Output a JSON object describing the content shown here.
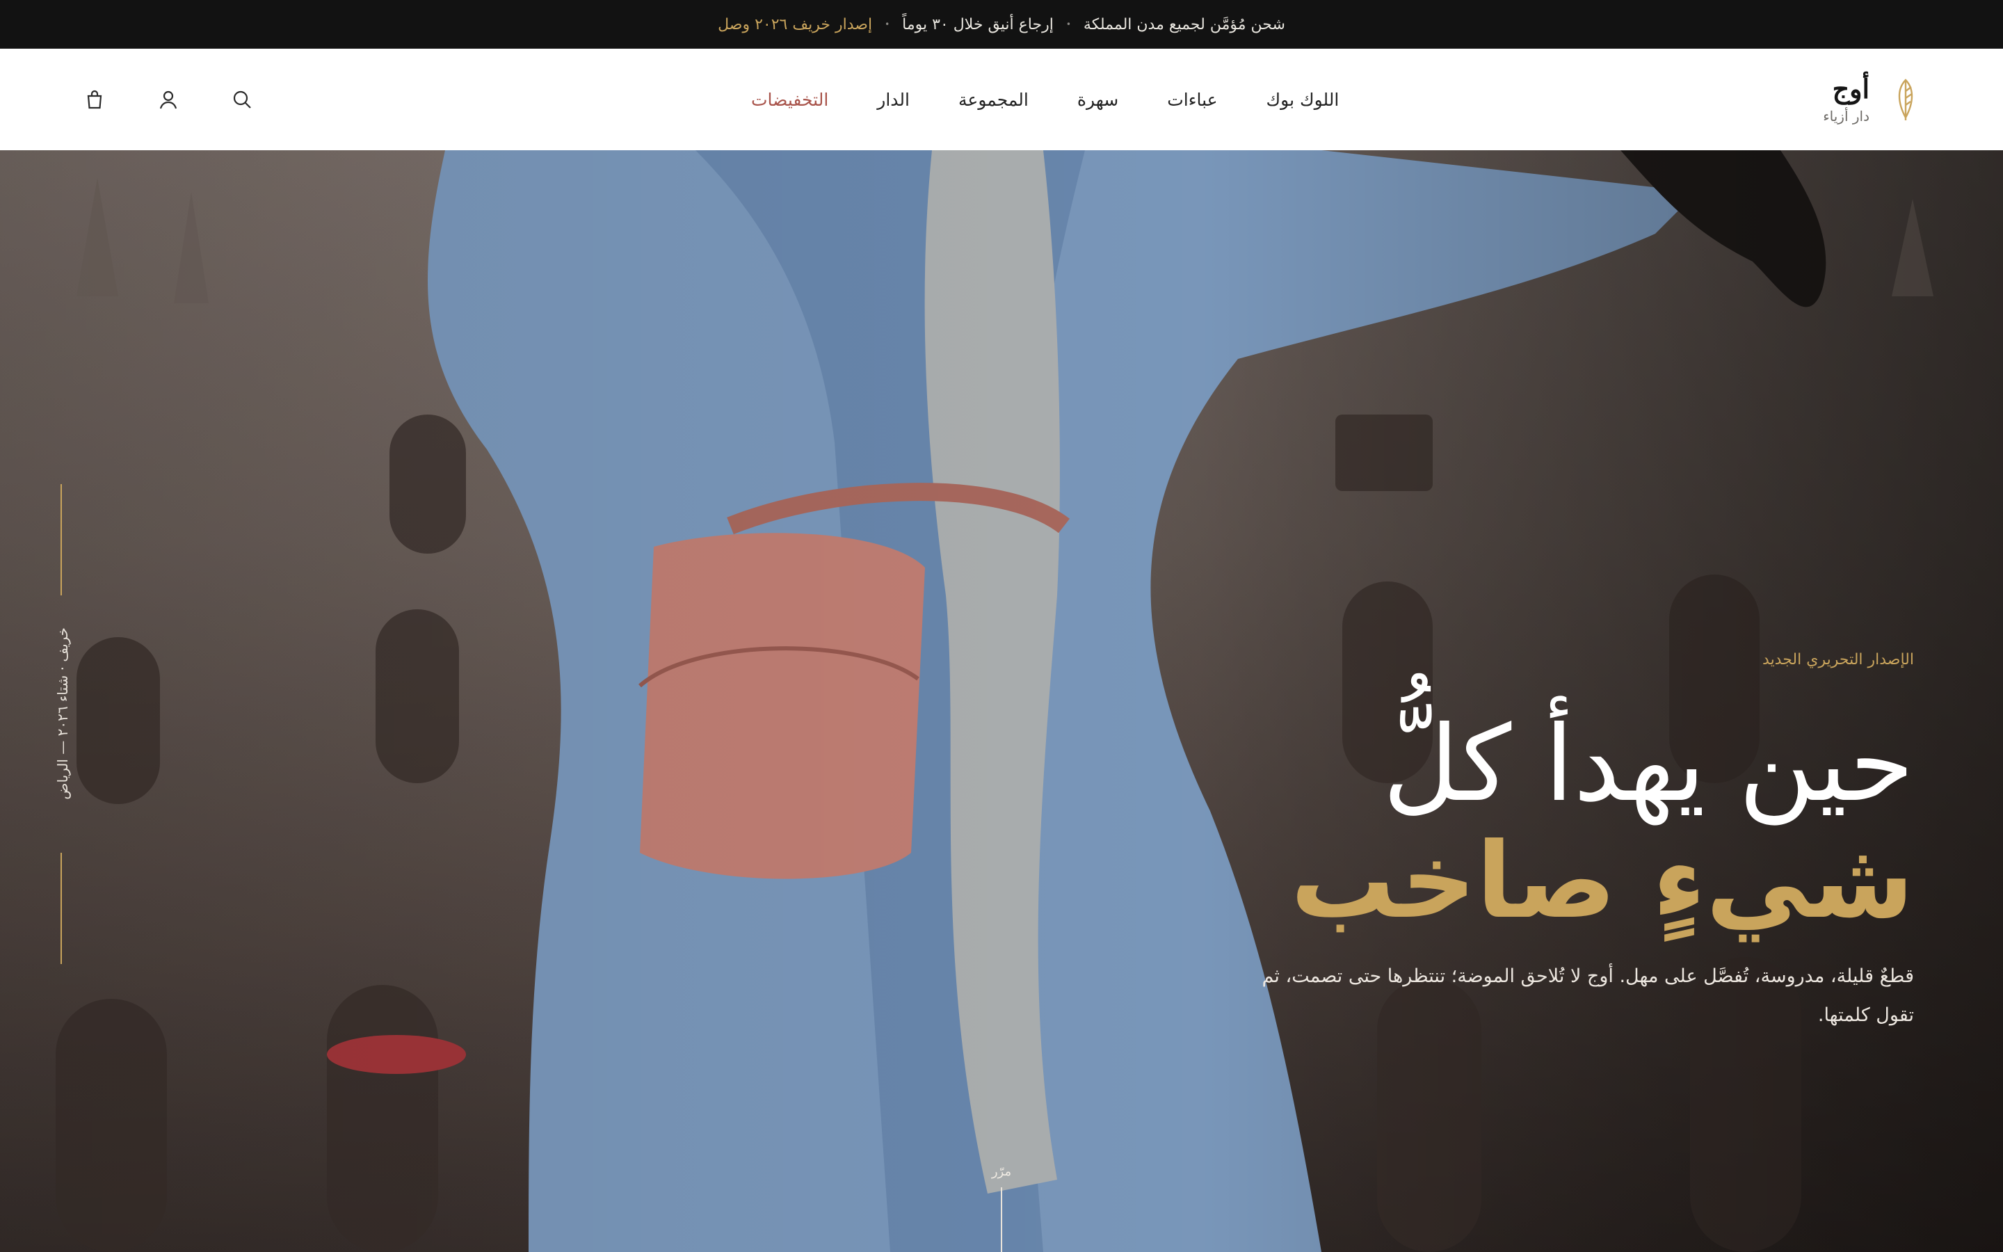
{
  "announcement": {
    "shipping": "شحن مُؤمَّن لجميع مدن المملكة",
    "returns": "إرجاع أنيق خلال ٣٠ يوماً",
    "collection": "إصدار خريف ٢٠٢٦ وصل"
  },
  "brand": {
    "name": "أوج",
    "subtitle": "دار أزياء",
    "mark_icon": "feather-mark-icon"
  },
  "nav": {
    "items": [
      {
        "label": "اللوك بوك"
      },
      {
        "label": "عباءات"
      },
      {
        "label": "سهرة"
      },
      {
        "label": "المجموعة"
      },
      {
        "label": "الدار"
      },
      {
        "label": "التخفيضات"
      }
    ]
  },
  "header_icons": [
    "search-icon",
    "user-icon",
    "bag-icon"
  ],
  "hero": {
    "side_meta": "خريف · شتاء ٢٠٢٦ — الرياض",
    "eyebrow": "الإصدار التحريري الجديد",
    "headline_line1": "حين يهدأ كلُّ",
    "headline_line2": "شيءٍ صاخب",
    "description": "قطعٌ قليلة، مدروسة، تُفصَّل على مهل. أوج لا تُلاحق الموضة؛ تنتظرها حتى تصمت، ثم تقول كلمتها.",
    "scroll_label": "مرّر"
  },
  "colors": {
    "accent_gold": "#c9a45c",
    "sale_red": "#a8534a",
    "announcement_bg": "#121212"
  }
}
